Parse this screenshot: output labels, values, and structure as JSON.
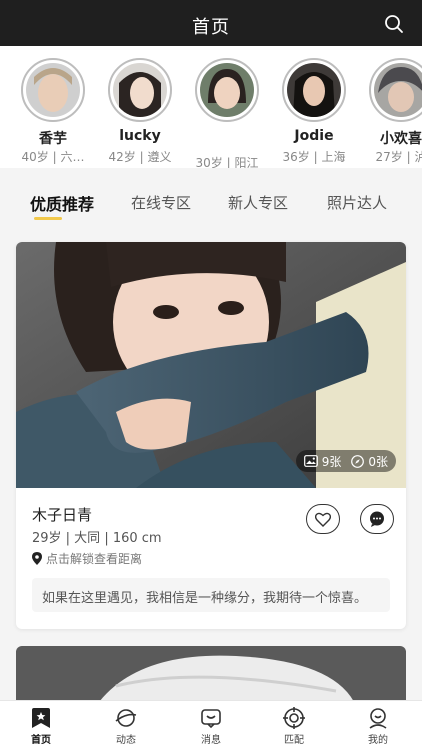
{
  "header": {
    "title": "首页"
  },
  "stories": [
    {
      "name": "香芋",
      "meta": "40岁 | 六…"
    },
    {
      "name": "lucky",
      "meta": "42岁 | 遵义"
    },
    {
      "name": "",
      "meta": "30岁 | 阳江"
    },
    {
      "name": "Jodie",
      "meta": "36岁 | 上海"
    },
    {
      "name": "小欢喜",
      "meta": "27岁 | 泸"
    }
  ],
  "tabs": [
    "优质推荐",
    "在线专区",
    "新人专区",
    "照片达人"
  ],
  "card": {
    "photo_count": "9张",
    "video_count": "0张",
    "name": "木子日青",
    "info": "29岁 | 大同 | 160 cm",
    "distance": "点击解锁查看距离",
    "quote": "如果在这里遇见，我相信是一种缘分，我期待一个惊喜。"
  },
  "nav": [
    "首页",
    "动态",
    "消息",
    "匹配",
    "我的"
  ],
  "colors": {
    "header_bg": "#1f1f1f",
    "accent": "#f2c94c"
  }
}
